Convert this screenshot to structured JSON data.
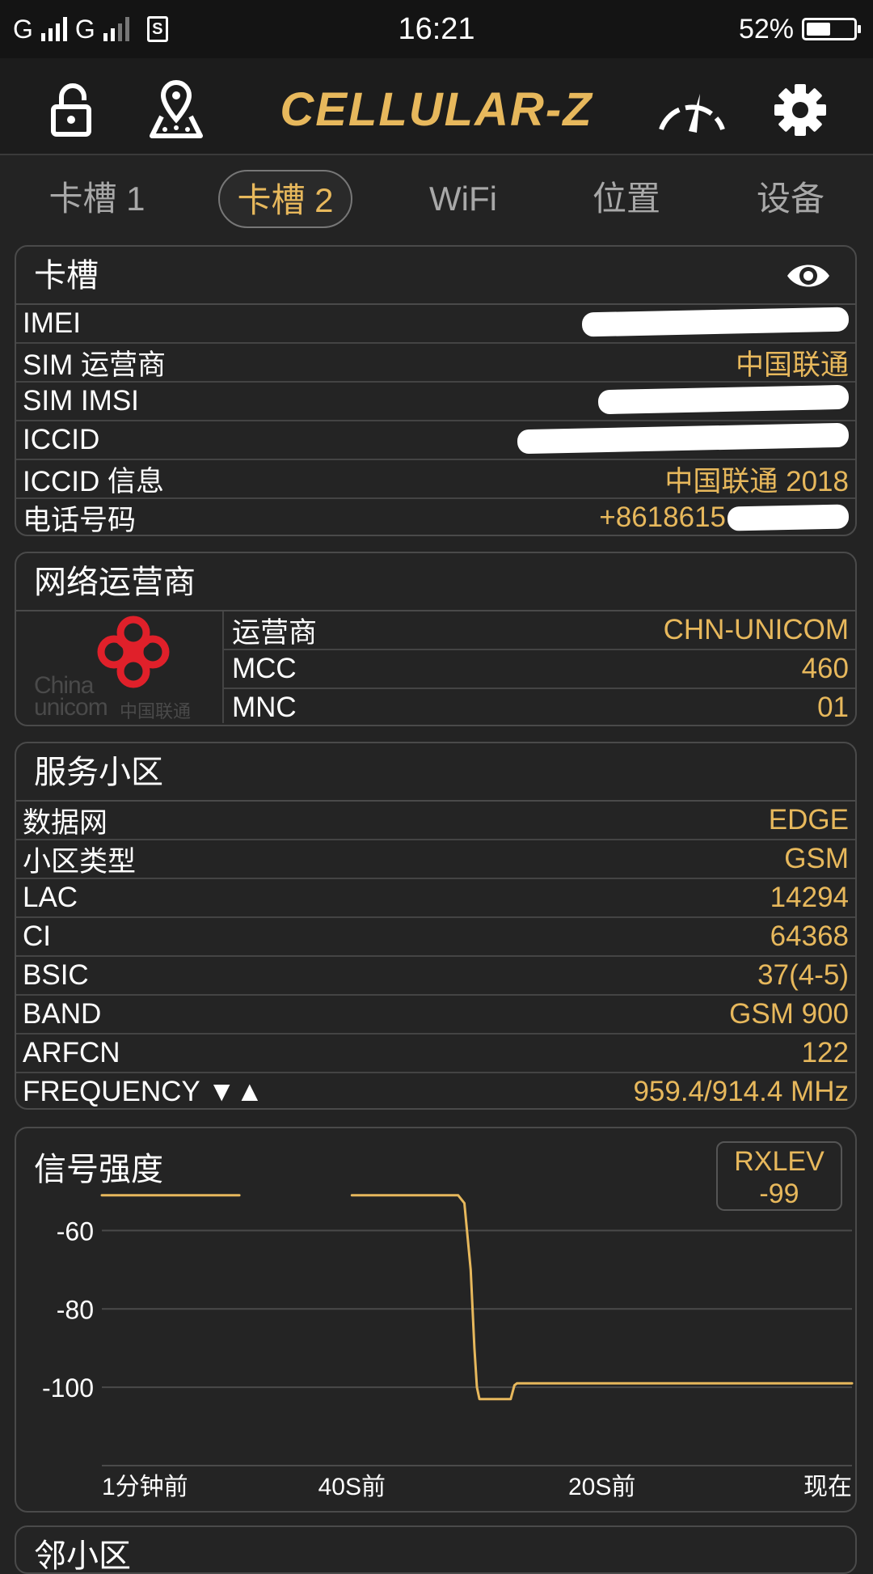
{
  "status_bar": {
    "network_1": "G",
    "network_2": "G",
    "sim_glyph": "S",
    "time": "16:21",
    "battery_percent": "52%",
    "battery_level": 0.52
  },
  "toolbar": {
    "app_title": "CELLULAR-Z",
    "icons": [
      "lock-open-icon",
      "map-pin-icon",
      "speedometer-icon",
      "gear-icon"
    ]
  },
  "tabs": [
    "卡槽 1",
    "卡槽 2",
    "WiFi",
    "位置",
    "设备"
  ],
  "active_tab": "卡槽 2",
  "sim_card": {
    "title": "卡槽",
    "rows": [
      {
        "label": "IMEI",
        "value": ""
      },
      {
        "label": "SIM 运营商",
        "value": "中国联通"
      },
      {
        "label": "SIM IMSI",
        "value": ""
      },
      {
        "label": "ICCID",
        "value": ""
      },
      {
        "label": "ICCID 信息",
        "value": "中国联通 2018"
      },
      {
        "label": "电话号码",
        "value": "+8618615"
      }
    ]
  },
  "network_operator": {
    "title": "网络运营商",
    "logo_text_1": "China",
    "logo_text_2": "unicom",
    "logo_text_cn": "中国联通",
    "rows": [
      {
        "label": "运营商",
        "value": "CHN-UNICOM"
      },
      {
        "label": "MCC",
        "value": "460"
      },
      {
        "label": "MNC",
        "value": "01"
      }
    ]
  },
  "serving_cell": {
    "title": "服务小区",
    "rows": [
      {
        "label": "数据网",
        "value": "EDGE"
      },
      {
        "label": "小区类型",
        "value": "GSM"
      },
      {
        "label": "LAC",
        "value": "14294"
      },
      {
        "label": "CI",
        "value": "64368"
      },
      {
        "label": "BSIC",
        "value": "37(4-5)"
      },
      {
        "label": "BAND",
        "value": "GSM 900"
      },
      {
        "label": "ARFCN",
        "value": "122"
      },
      {
        "label": "FREQUENCY ▼▲",
        "value": "959.4/914.4 MHz"
      }
    ]
  },
  "signal_strength": {
    "title": "信号强度",
    "badge_label": "RXLEV",
    "badge_value": "-99"
  },
  "chart_data": {
    "type": "line",
    "title": "信号强度",
    "xlabel": "",
    "ylabel": "",
    "x_tick_labels": [
      "1分钟前",
      "40S前",
      "20S前",
      "现在"
    ],
    "y_ticks": [
      -60,
      -80,
      -100
    ],
    "xlim": [
      -60,
      0
    ],
    "ylim": [
      -120,
      -50
    ],
    "grid": true,
    "color": "#e7b85c",
    "series": [
      {
        "segments": [
          {
            "x": [
              -60,
              -49
            ],
            "y": [
              -51,
              -51
            ]
          },
          {
            "x": [
              -40,
              -31.5,
              -31,
              -30.5,
              -30.2,
              -30,
              -29.8,
              -28,
              -27.3,
              -27,
              -26.8,
              0
            ],
            "y": [
              -51,
              -51,
              -53,
              -70,
              -90,
              -100,
              -103,
              -103,
              -103,
              -99.5,
              -99,
              -99
            ]
          }
        ]
      }
    ]
  },
  "neighbor_cell": {
    "title": "邻小区"
  }
}
